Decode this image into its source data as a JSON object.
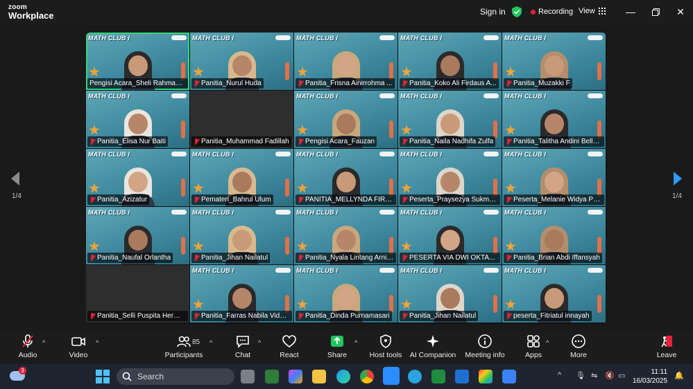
{
  "app": {
    "logo_line1": "zoom",
    "logo_line2": "Workplace"
  },
  "topbar": {
    "sign_in": "Sign in",
    "recording": "Recording",
    "view": "View"
  },
  "paging": {
    "left_page": "1/4",
    "right_page": "1/4"
  },
  "participants": [
    {
      "name": "Pengisi Acara_Sheli Rahmadina",
      "video": true,
      "muted": false,
      "active": true
    },
    {
      "name": "Panitia_Nurul Huda",
      "video": true,
      "muted": true
    },
    {
      "name": "Panitia_Frisna Ainirrohma ...",
      "video": true,
      "muted": true
    },
    {
      "name": "Panitia_Koko Ali Firdaus A...",
      "video": true,
      "muted": true
    },
    {
      "name": "Panitia_Muzakki F",
      "video": true,
      "muted": true
    },
    {
      "name": "Panitia_Elisa Nur Baiti",
      "video": true,
      "muted": true
    },
    {
      "name": "Panitia_Muhammad Fadillah",
      "video": false,
      "muted": true
    },
    {
      "name": "Pengisi Acara_Fauzan",
      "video": true,
      "muted": true
    },
    {
      "name": "Panitia_Naila Nadhifa Zulfa",
      "video": true,
      "muted": true
    },
    {
      "name": "Panitia_Talitha Andini Bella ...",
      "video": true,
      "muted": true
    },
    {
      "name": "Panitia_Azizatur",
      "video": true,
      "muted": true
    },
    {
      "name": "Pemateri_Bahrul Ulum",
      "video": true,
      "muted": true
    },
    {
      "name": "PANITIA_MELLYNDA FIRDIA...",
      "video": true,
      "muted": true
    },
    {
      "name": "Peserta_Praysezya Sukma Ri...",
      "video": true,
      "muted": true
    },
    {
      "name": "Peserta_Melanie Widya Putri",
      "video": true,
      "muted": true
    },
    {
      "name": "Panitia_Naufal Orlantha",
      "video": true,
      "muted": true
    },
    {
      "name": "Panitia_Jihan Nailatul",
      "video": true,
      "muted": true
    },
    {
      "name": "Panitia_Nyala Lintang Arni P...",
      "video": true,
      "muted": true
    },
    {
      "name": "PESERTA VIA DWI OKTAVIYA...",
      "video": true,
      "muted": true
    },
    {
      "name": "Panitia_Brian Abdi Iffansyah",
      "video": true,
      "muted": true
    },
    {
      "name": "Panitia_Selli Puspita Hermad...",
      "video": false,
      "muted": true
    },
    {
      "name": "Panitia_Farras Nabila Vidyar...",
      "video": true,
      "muted": true
    },
    {
      "name": "Panitia_Dinda Purnamasari",
      "video": true,
      "muted": true
    },
    {
      "name": "Panitia_Jihan Nailatul",
      "video": true,
      "muted": true
    },
    {
      "name": "peserta_Fitriatul innayah",
      "video": true,
      "muted": true
    }
  ],
  "tile_banner": "MATH CLUB I",
  "controls": {
    "audio": "Audio",
    "video": "Video",
    "participants": "Participants",
    "participants_count": "85",
    "chat": "Chat",
    "react": "React",
    "share": "Share",
    "host_tools": "Host tools",
    "ai_companion": "AI Companion",
    "meeting_info": "Meeting info",
    "apps": "Apps",
    "more": "More",
    "leave": "Leave"
  },
  "taskbar": {
    "search_placeholder": "Search",
    "notification_count": "3",
    "time": "11:11",
    "date": "16/03/2025"
  },
  "colors": {
    "accent_green": "#34d67a",
    "recording_red": "#e0243a",
    "share_green": "#22c55e",
    "leave_red": "#e0243a"
  }
}
